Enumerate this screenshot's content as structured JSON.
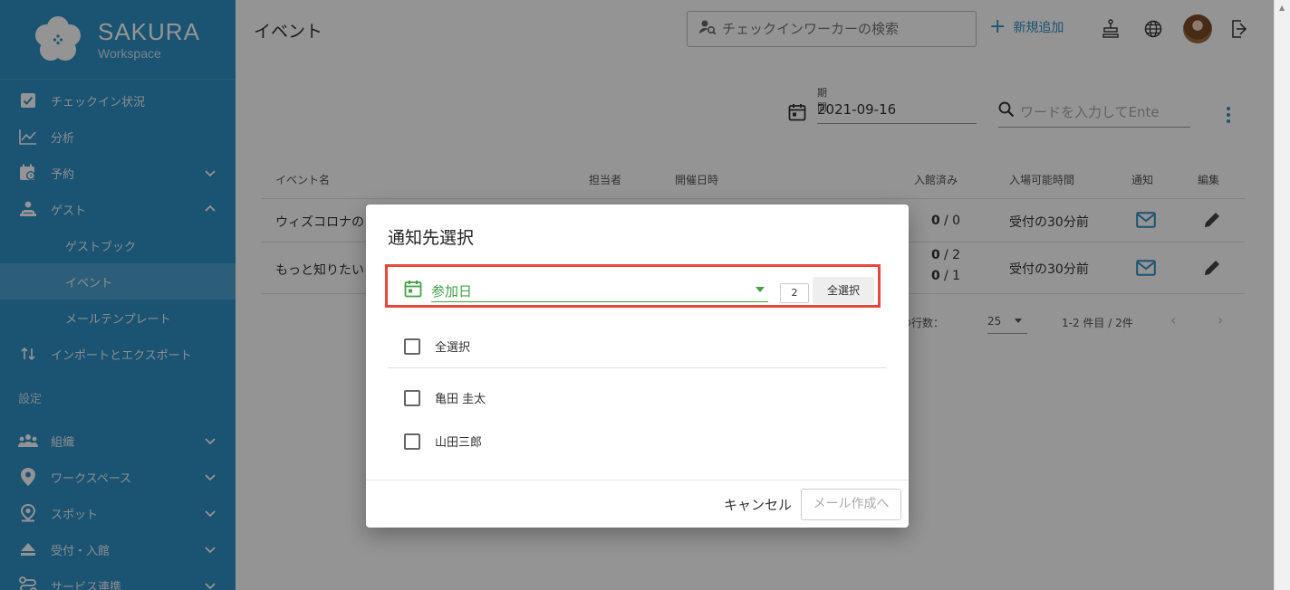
{
  "app": {
    "logo_name": "SAKURA",
    "logo_sub": "Workspace"
  },
  "sidebar": {
    "items": [
      {
        "label": "チェックイン状況"
      },
      {
        "label": "分析"
      },
      {
        "label": "予約"
      },
      {
        "label": "ゲスト"
      },
      {
        "label": "ゲストブック"
      },
      {
        "label": "イベント"
      },
      {
        "label": "メールテンプレート"
      },
      {
        "label": "インポートとエクスポート"
      }
    ],
    "section_label": "設定",
    "settings_items": [
      {
        "label": "組織"
      },
      {
        "label": "ワークスペース"
      },
      {
        "label": "スポット"
      },
      {
        "label": "受付・入館"
      },
      {
        "label": "サービス連携"
      }
    ]
  },
  "header": {
    "title": "イベント",
    "search_placeholder": "チェックインワーカーの検索",
    "add_label": "新規追加"
  },
  "filters": {
    "period_label": "期間",
    "period_value": "2021-09-16",
    "word_placeholder": "ワードを入力してEnte"
  },
  "table": {
    "headers": {
      "name": "イベント名",
      "owner": "担当者",
      "datetime": "開催日時",
      "checked_in": "入館済み",
      "entry_time": "入場可能時間",
      "notify": "通知",
      "edit": "編集"
    },
    "rows": [
      {
        "name": "ウィズコロナの",
        "checked_in_a": "0",
        "checked_in_b": "/ 0",
        "entry_time": "受付の30分前"
      },
      {
        "name": "もっと知りたい",
        "checked_in_a": "0",
        "checked_in_b": "/ 2",
        "checked_in_c": "0",
        "checked_in_d": "/ 1",
        "entry_time": "受付の30分前"
      }
    ],
    "pager": {
      "rows_label": "の行数：",
      "rows_value": "25",
      "range": "1-2 件目 / 2件"
    }
  },
  "dialog": {
    "title": "通知先選択",
    "select_value": "参加日",
    "count": "2",
    "select_all_button": "全選択",
    "select_all_checkbox": "全選択",
    "people": [
      {
        "name": "亀田 圭太"
      },
      {
        "name": "山田三郎"
      }
    ],
    "cancel": "キャンセル",
    "compose": "メール作成へ"
  },
  "colors": {
    "sidebar": "#2f8fc4",
    "accent": "#2f8fc4",
    "green": "#43a047",
    "highlight": "#e5483d"
  }
}
